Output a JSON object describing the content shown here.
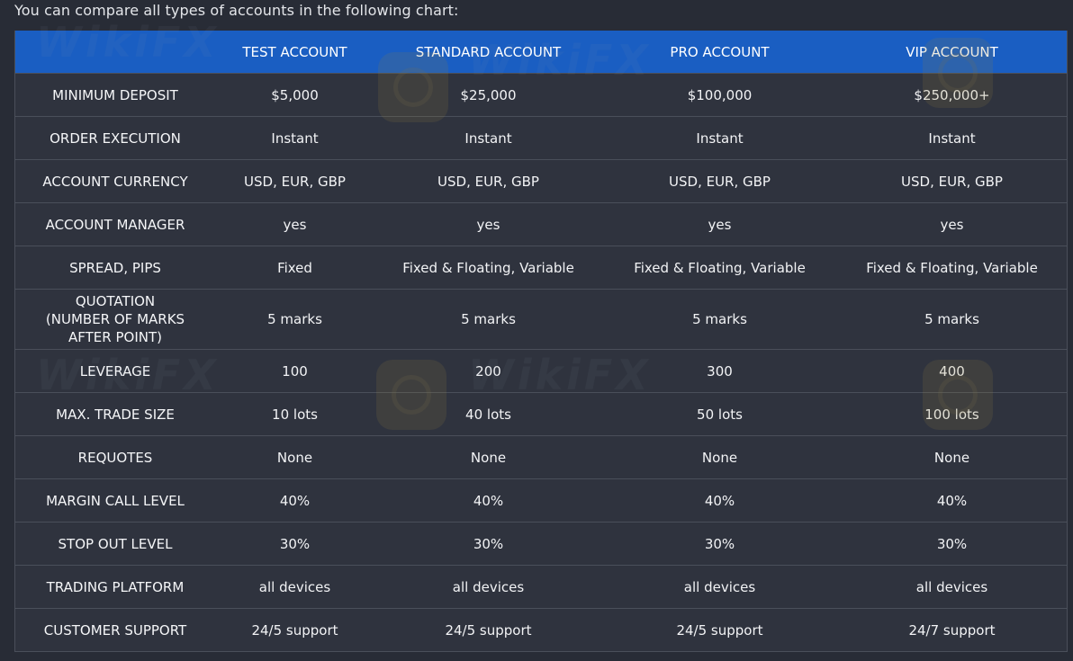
{
  "intro_text": "You can compare all types of accounts in the following chart:",
  "colors": {
    "header_bg": "#1a5ec2",
    "row_bg": "#2f333e",
    "page_bg": "#282c36",
    "border": "#4a4f5a"
  },
  "table": {
    "headers": [
      "",
      "TEST ACCOUNT",
      "STANDARD ACCOUNT",
      "PRO ACCOUNT",
      "VIP ACCOUNT"
    ],
    "rows": [
      {
        "label": "MINIMUM DEPOSIT",
        "values": [
          "$5,000",
          "$25,000",
          "$100,000",
          "$250,000+"
        ]
      },
      {
        "label": "ORDER EXECUTION",
        "values": [
          "Instant",
          "Instant",
          "Instant",
          "Instant"
        ]
      },
      {
        "label": "ACCOUNT CURRENCY",
        "values": [
          "USD, EUR, GBP",
          "USD, EUR, GBP",
          "USD, EUR, GBP",
          "USD, EUR, GBP"
        ]
      },
      {
        "label": "ACCOUNT MANAGER",
        "values": [
          "yes",
          "yes",
          "yes",
          "yes"
        ]
      },
      {
        "label": "SPREAD, PIPS",
        "values": [
          "Fixed",
          "Fixed & Floating, Variable",
          "Fixed & Floating, Variable",
          "Fixed & Floating, Variable"
        ]
      },
      {
        "label": "QUOTATION\n(NUMBER OF MARKS\nAFTER POINT)",
        "values": [
          "5 marks",
          "5 marks",
          "5 marks",
          "5 marks"
        ]
      },
      {
        "label": "LEVERAGE",
        "values": [
          "100",
          "200",
          "300",
          "400"
        ]
      },
      {
        "label": "MAX. TRADE SIZE",
        "values": [
          "10 lots",
          "40 lots",
          "50 lots",
          "100 lots"
        ]
      },
      {
        "label": "REQUOTES",
        "values": [
          "None",
          "None",
          "None",
          "None"
        ]
      },
      {
        "label": "MARGIN CALL LEVEL",
        "values": [
          "40%",
          "40%",
          "40%",
          "40%"
        ]
      },
      {
        "label": "STOP OUT LEVEL",
        "values": [
          "30%",
          "30%",
          "30%",
          "30%"
        ]
      },
      {
        "label": "TRADING PLATFORM",
        "values": [
          "all devices",
          "all devices",
          "all devices",
          "all devices"
        ]
      },
      {
        "label": "CUSTOMER SUPPORT",
        "values": [
          "24/5 support",
          "24/5 support",
          "24/5 support",
          "24/7 support"
        ]
      }
    ]
  },
  "watermark": {
    "text": "WikiFX",
    "icon": "wikifx-logo-icon"
  }
}
